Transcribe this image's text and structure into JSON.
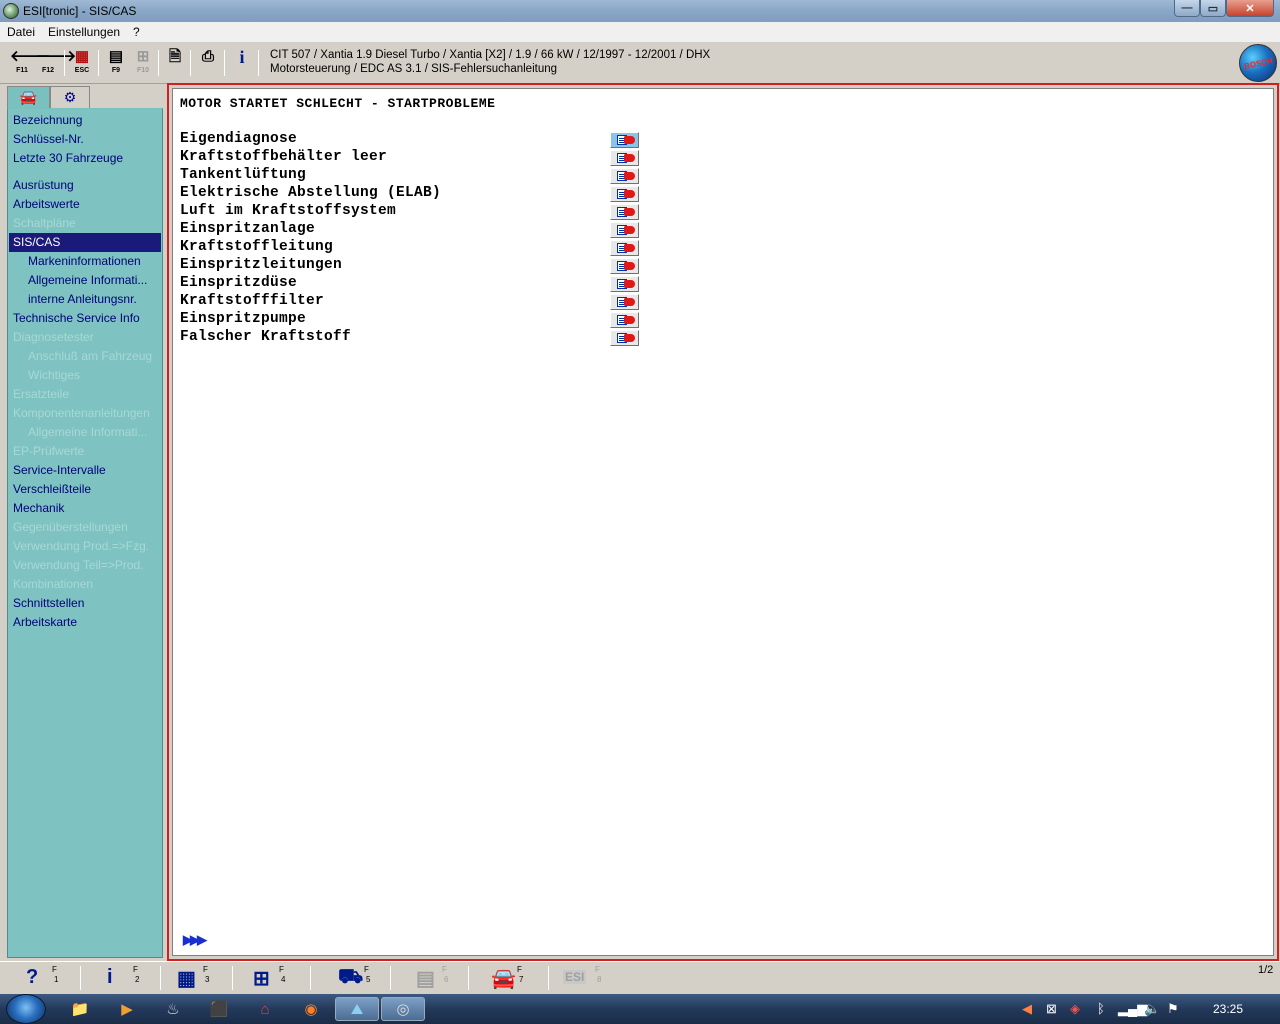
{
  "window": {
    "title": "ESI[tronic] - SIS/CAS"
  },
  "menu": {
    "items": [
      "Datei",
      "Einstellungen",
      "?"
    ]
  },
  "toolbar": {
    "buttons": [
      {
        "icon": "arrow-left-icon",
        "glyph": "🡐",
        "key": "F11"
      },
      {
        "icon": "arrow-right-icon",
        "glyph": "🡒",
        "key": "F12"
      },
      {
        "icon": "exit-icon",
        "glyph": "▦",
        "key": "ESC"
      },
      {
        "icon": "list-icon",
        "glyph": "▤",
        "key": "F9"
      },
      {
        "icon": "tree-icon",
        "glyph": "⊞",
        "key": "F10"
      },
      {
        "icon": "document-icon",
        "glyph": "🗎",
        "key": ""
      },
      {
        "icon": "printer-icon",
        "glyph": "⎙",
        "key": ""
      },
      {
        "icon": "info-icon",
        "glyph": "i",
        "key": ""
      }
    ],
    "vehicle_line1": "CIT 507 / Xantia 1.9 Diesel Turbo / Xantia [X2] / 1.9 / 66 kW / 12/1997 - 12/2001 / DHX",
    "vehicle_line2": "Motorsteuerung / EDC AS 3.1  / SIS-Fehlersuchanleitung",
    "logo_text": "BOSCH"
  },
  "sidebar": {
    "tabs": [
      {
        "icon": "car-icon",
        "glyph": "🚘"
      },
      {
        "icon": "engine-icon",
        "glyph": "⚙"
      }
    ],
    "items": [
      {
        "label": "Bezeichnung",
        "state": "enabled",
        "sub": false
      },
      {
        "label": "Schlüssel-Nr.",
        "state": "enabled",
        "sub": false
      },
      {
        "label": "Letzte 30 Fahrzeuge",
        "state": "enabled",
        "sub": false
      },
      {
        "label": "Ausrüstung",
        "state": "enabled",
        "sub": false
      },
      {
        "label": "Arbeitswerte",
        "state": "enabled",
        "sub": false
      },
      {
        "label": "Schaltpläne",
        "state": "disabled",
        "sub": false
      },
      {
        "label": "SIS/CAS",
        "state": "selected",
        "sub": false
      },
      {
        "label": "Markeninformationen",
        "state": "enabled",
        "sub": true
      },
      {
        "label": "Allgemeine Informati...",
        "state": "enabled",
        "sub": true
      },
      {
        "label": "interne Anleitungsnr.",
        "state": "enabled",
        "sub": true
      },
      {
        "label": "Technische Service Info",
        "state": "enabled",
        "sub": false
      },
      {
        "label": "Diagnosetester",
        "state": "disabled",
        "sub": false
      },
      {
        "label": "Anschluß am Fahrzeug",
        "state": "disabled",
        "sub": true
      },
      {
        "label": "Wichtiges",
        "state": "disabled",
        "sub": true
      },
      {
        "label": "Ersatzteile",
        "state": "disabled",
        "sub": false
      },
      {
        "label": "Komponentenanleitungen",
        "state": "disabled",
        "sub": false
      },
      {
        "label": "Allgemeine Informati...",
        "state": "disabled",
        "sub": true
      },
      {
        "label": "EP-Prüfwerte",
        "state": "disabled",
        "sub": false
      },
      {
        "label": "Service-Intervalle",
        "state": "enabled",
        "sub": false
      },
      {
        "label": "Verschleißteile",
        "state": "enabled",
        "sub": false
      },
      {
        "label": "Mechanik",
        "state": "enabled",
        "sub": false
      },
      {
        "label": "Gegenüberstellungen",
        "state": "disabled",
        "sub": false
      },
      {
        "label": "Verwendung Prod.=>Fzg.",
        "state": "disabled",
        "sub": false
      },
      {
        "label": "Verwendung Teil=>Prod.",
        "state": "disabled",
        "sub": false
      },
      {
        "label": "Kombinationen",
        "state": "disabled",
        "sub": false
      },
      {
        "label": "Schnittstellen",
        "state": "enabled",
        "sub": false
      },
      {
        "label": "Arbeitskarte",
        "state": "enabled",
        "sub": false
      }
    ]
  },
  "content": {
    "title": "MOTOR STARTET SCHLECHT - STARTPROBLEME",
    "items": [
      "Eigendiagnose",
      "Kraftstoffbehälter leer",
      "Tankentlüftung",
      "Elektrische Abstellung (ELAB)",
      "Luft im Kraftstoffsystem",
      "Einspritzanlage",
      "Kraftstoffleitung",
      "Einspritzleitungen",
      "Einspritzdüse",
      "Kraftstofffilter",
      "Einspritzpumpe",
      "Falscher Kraftstoff"
    ],
    "next_glyph": "▶▶▶"
  },
  "function_bar": {
    "buttons": [
      {
        "icon": "help-icon",
        "glyph": "?",
        "key_f": "F",
        "key_n": "1",
        "state": "enabled"
      },
      {
        "icon": "info-icon",
        "glyph": "i",
        "key_f": "F",
        "key_n": "2",
        "state": "enabled"
      },
      {
        "icon": "components-icon",
        "glyph": "▦",
        "key_f": "F",
        "key_n": "3",
        "state": "enabled"
      },
      {
        "icon": "circuit-icon",
        "glyph": "⊞",
        "key_f": "F",
        "key_n": "4",
        "state": "enabled"
      },
      {
        "icon": "tester-icon",
        "glyph": "⛟",
        "key_f": "F",
        "key_n": "5",
        "state": "enabled"
      },
      {
        "icon": "parts-icon",
        "glyph": "▤",
        "key_f": "F",
        "key_n": "6",
        "state": "disabled"
      },
      {
        "icon": "vehicle-icon",
        "glyph": "🚘",
        "key_f": "F",
        "key_n": "7",
        "state": "enabled"
      },
      {
        "icon": "esi-icon",
        "glyph": "ESI",
        "key_f": "F",
        "key_n": "8",
        "state": "disabled"
      }
    ],
    "page_indicator": "1/2"
  },
  "taskbar": {
    "apps": [
      {
        "icon": "explorer-icon",
        "glyph": "📁"
      },
      {
        "icon": "media-icon",
        "glyph": "▶"
      },
      {
        "icon": "steam-icon",
        "glyph": "♨"
      },
      {
        "icon": "pdf-icon",
        "glyph": "⬛"
      },
      {
        "icon": "app-icon",
        "glyph": "⌂"
      },
      {
        "icon": "firefox-icon",
        "glyph": "◉"
      },
      {
        "icon": "esi-app-icon",
        "glyph": "⛰"
      },
      {
        "icon": "disc-icon",
        "glyph": "◎"
      }
    ],
    "clock": "23:25"
  }
}
